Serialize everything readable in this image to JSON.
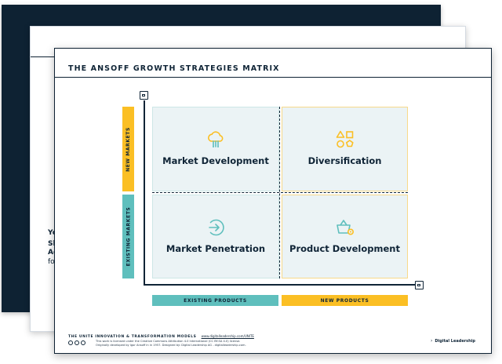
{
  "middle_sheet": {
    "lines": [
      "Yo",
      "Sh",
      "Ac",
      "fo"
    ]
  },
  "page": {
    "title": "THE ANSOFF GROWTH STRATEGIES MATRIX"
  },
  "matrix": {
    "y_axis": {
      "top_label": "NEW MARKETS",
      "bottom_label": "EXISTING MARKETS",
      "icon": "storefront-icon"
    },
    "x_axis": {
      "left_label": "EXISTING PRODUCTS",
      "right_label": "NEW PRODUCTS",
      "icon": "product-box-icon"
    },
    "quadrants": [
      {
        "label": "Market Development",
        "icon": "cloud-icon",
        "color": "#fbbf24"
      },
      {
        "label": "Diversification",
        "icon": "shapes-icon",
        "color": "#fbbf24"
      },
      {
        "label": "Market Penetration",
        "icon": "arrow-in-circle-icon",
        "color": "#5fbfbd"
      },
      {
        "label": "Product Development",
        "icon": "basket-gear-icon",
        "color": "#fbbf24"
      }
    ],
    "colors": {
      "yellow": "#fbbf24",
      "teal": "#5fbfbd",
      "navy": "#0f2436",
      "cell_bg": "#ebf3f5"
    }
  },
  "footer": {
    "series": "THE UNITE INNOVATION & TRANSFORMATION MODELS",
    "url": "www.digitalleadership.com/UNITE",
    "license_lines": [
      "This work is licensed under the Creative Commons Attribution 4.0 International (CC BY-SA 4.0) license.",
      "Originally developed by Igor Ansoff in in 1957. Designed by: Digital Leadership AG - digitalleadership.com."
    ],
    "brand": "Digital Leadership"
  }
}
